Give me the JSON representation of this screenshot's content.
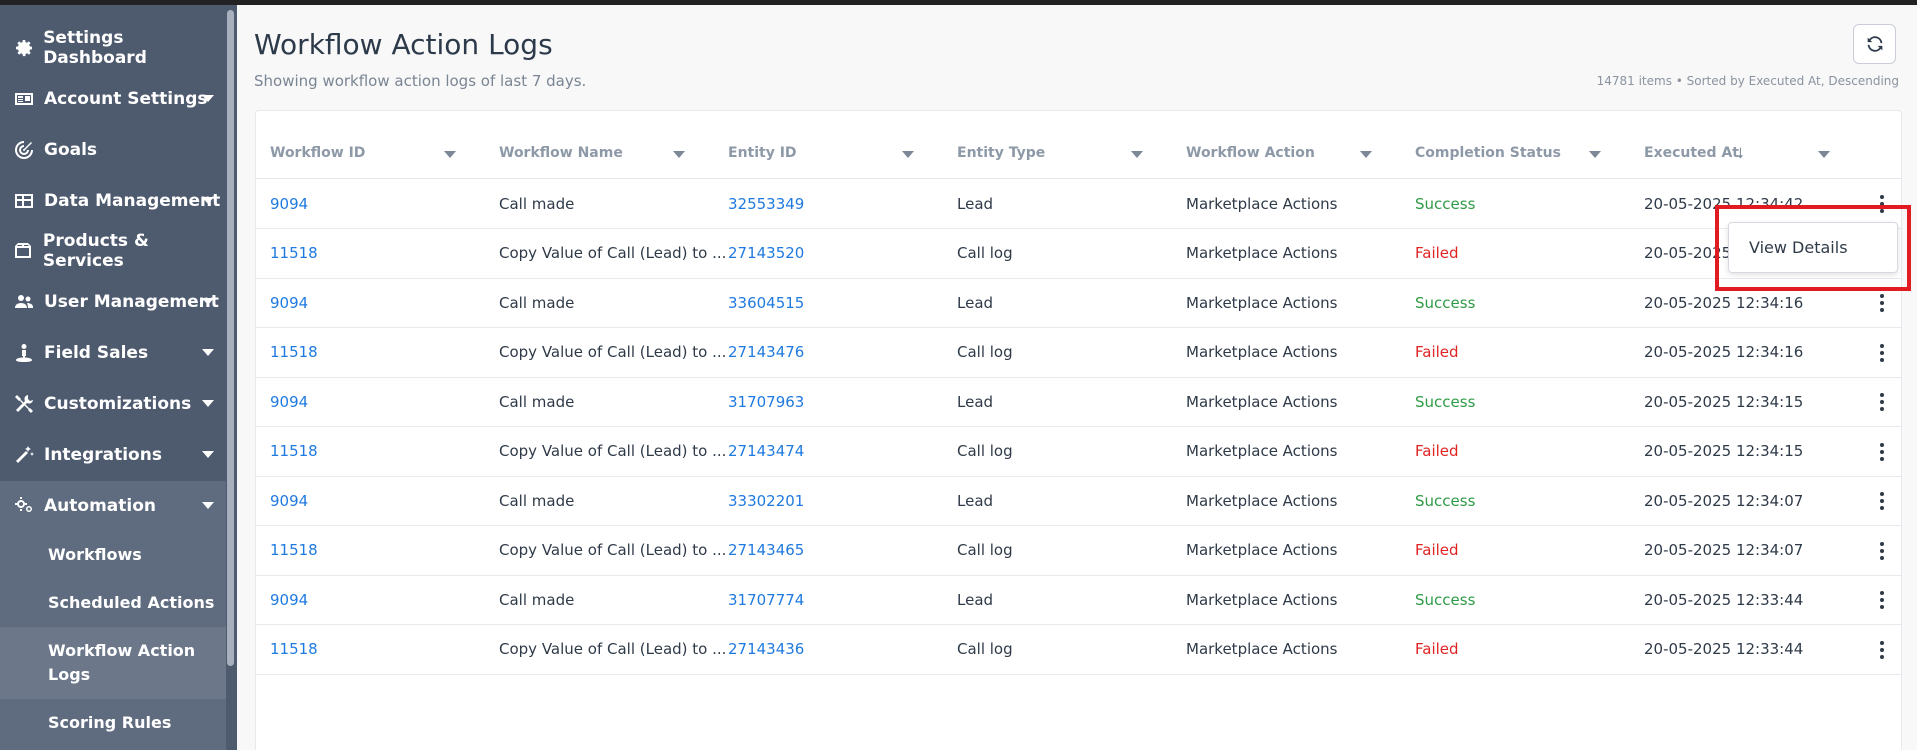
{
  "sidebar": {
    "items": [
      {
        "label": "Settings Dashboard",
        "icon": "gear-icon",
        "caret": false
      },
      {
        "label": "Account Settings",
        "icon": "id-card-icon",
        "caret": true
      },
      {
        "label": "Goals",
        "icon": "target-icon",
        "caret": false
      },
      {
        "label": "Data Management",
        "icon": "table-icon",
        "caret": true
      },
      {
        "label": "Products & Services",
        "icon": "box-icon",
        "caret": false
      },
      {
        "label": "User Management",
        "icon": "users-icon",
        "caret": true
      },
      {
        "label": "Field Sales",
        "icon": "person-pin-icon",
        "caret": true
      },
      {
        "label": "Customizations",
        "icon": "tools-icon",
        "caret": true
      },
      {
        "label": "Integrations",
        "icon": "magic-wand-icon",
        "caret": true
      },
      {
        "label": "Automation",
        "icon": "cogs-icon",
        "caret": true
      }
    ],
    "sub_items": [
      "Workflows",
      "Scheduled Actions",
      "Workflow Action Logs",
      "Scoring Rules"
    ]
  },
  "header": {
    "title": "Workflow Action Logs",
    "subtitle": "Showing workflow action logs of last 7 days.",
    "meta": "14781 items • Sorted by Executed At, Descending"
  },
  "table": {
    "columns": [
      "Workflow ID",
      "Workflow Name",
      "Entity ID",
      "Entity Type",
      "Workflow Action",
      "Completion Status",
      "Executed At"
    ],
    "rows": [
      [
        "9094",
        "Call made",
        "32553349",
        "Lead",
        "Marketplace Actions",
        "Success",
        "20-05-2025 12:34:42"
      ],
      [
        "11518",
        "Copy Value of Call (Lead) to ...",
        "27143520",
        "Call log",
        "Marketplace Actions",
        "Failed",
        "20-05-2025 12:34:42"
      ],
      [
        "9094",
        "Call made",
        "33604515",
        "Lead",
        "Marketplace Actions",
        "Success",
        "20-05-2025 12:34:16"
      ],
      [
        "11518",
        "Copy Value of Call (Lead) to ...",
        "27143476",
        "Call log",
        "Marketplace Actions",
        "Failed",
        "20-05-2025 12:34:16"
      ],
      [
        "9094",
        "Call made",
        "31707963",
        "Lead",
        "Marketplace Actions",
        "Success",
        "20-05-2025 12:34:15"
      ],
      [
        "11518",
        "Copy Value of Call (Lead) to ...",
        "27143474",
        "Call log",
        "Marketplace Actions",
        "Failed",
        "20-05-2025 12:34:15"
      ],
      [
        "9094",
        "Call made",
        "33302201",
        "Lead",
        "Marketplace Actions",
        "Success",
        "20-05-2025 12:34:07"
      ],
      [
        "11518",
        "Copy Value of Call (Lead) to ...",
        "27143465",
        "Call log",
        "Marketplace Actions",
        "Failed",
        "20-05-2025 12:34:07"
      ],
      [
        "9094",
        "Call made",
        "31707774",
        "Lead",
        "Marketplace Actions",
        "Success",
        "20-05-2025 12:33:44"
      ],
      [
        "11518",
        "Copy Value of Call (Lead) to ...",
        "27143436",
        "Call log",
        "Marketplace Actions",
        "Failed",
        "20-05-2025 12:33:44"
      ]
    ]
  },
  "popup": {
    "label": "View Details"
  },
  "colors": {
    "success": "#2e9b46",
    "failed": "#e02424",
    "link": "#1f7ae0",
    "sidebar": "#4e5a6e",
    "highlight": "#e11b22"
  }
}
